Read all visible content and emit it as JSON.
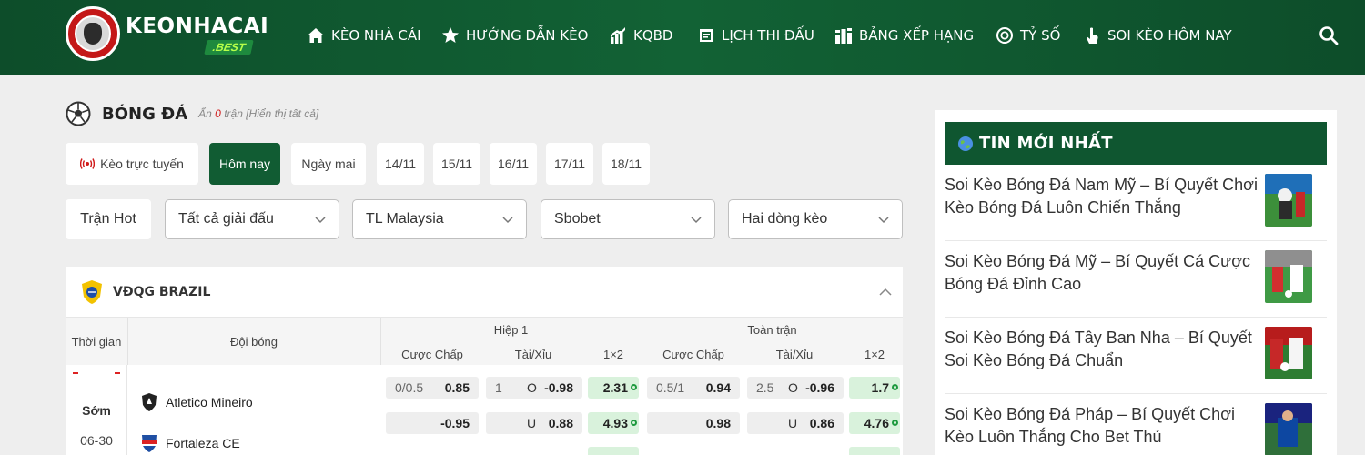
{
  "brand": {
    "name": "KEONHACAI",
    "sub": ".BEST"
  },
  "nav": [
    {
      "label": "KÈO NHÀ CÁI",
      "icon": "home-icon"
    },
    {
      "label": "HƯỚNG DẪN KÈO",
      "icon": "star-icon"
    },
    {
      "label": "KQBD",
      "icon": "bar-chart-icon"
    },
    {
      "label": "LỊCH THI ĐẤU",
      "icon": "calendar-icon"
    },
    {
      "label": "BẢNG XẾP HẠNG",
      "icon": "ranking-icon"
    },
    {
      "label": "TỶ SỐ",
      "icon": "target-icon"
    },
    {
      "label": "SOI KÈO HÔM NAY",
      "icon": "touch-icon"
    }
  ],
  "section": {
    "title": "BÓNG ĐÁ",
    "hint_prefix": "Ẩn",
    "hint_count": "0",
    "hint_suffix": "trận [Hiển thị tất cả]"
  },
  "date_tabs": [
    {
      "label": "Kèo trực tuyến",
      "active": false
    },
    {
      "label": "Hôm nay",
      "active": true
    },
    {
      "label": "Ngày mai",
      "active": false
    },
    {
      "label": "14/11",
      "active": false
    },
    {
      "label": "15/11",
      "active": false
    },
    {
      "label": "16/11",
      "active": false
    },
    {
      "label": "17/11",
      "active": false
    },
    {
      "label": "18/11",
      "active": false
    }
  ],
  "filters": {
    "hot_label": "Trận Hot",
    "selects": [
      "Tất cả giải đấu",
      "TL Malaysia",
      "Sbobet",
      "Hai dòng kèo"
    ]
  },
  "league": {
    "name": "VĐQG BRAZIL"
  },
  "table": {
    "col_time": "Thời gian",
    "col_team": "Đội bóng",
    "group_first_half": "Hiệp 1",
    "group_full": "Toàn trận",
    "sub_handicap": "Cược Chấp",
    "sub_overunder": "Tài/Xỉu",
    "sub_1x2": "1×2"
  },
  "match": {
    "status": "Sớm",
    "kickoff": "06-30",
    "home": "Atletico Mineiro",
    "away": "Fortaleza CE",
    "rows": [
      {
        "h1_hc_line": "0/0.5",
        "h1_hc_val": "0.85",
        "h1_ou_line": "1",
        "h1_ou_side": "O",
        "h1_ou_val": "-0.98",
        "h1_1x2": "2.31",
        "ft_hc_line": "0.5/1",
        "ft_hc_val": "0.94",
        "ft_ou_line": "2.5",
        "ft_ou_side": "O",
        "ft_ou_val": "-0.96",
        "ft_1x2": "1.7"
      },
      {
        "h1_hc_line": "",
        "h1_hc_val": "-0.95",
        "h1_ou_line": "",
        "h1_ou_side": "U",
        "h1_ou_val": "0.88",
        "h1_1x2": "4.93",
        "ft_hc_line": "",
        "ft_hc_val": "0.98",
        "ft_ou_line": "",
        "ft_ou_side": "U",
        "ft_ou_val": "0.86",
        "ft_1x2": "4.76"
      }
    ]
  },
  "sidebar": {
    "title": "TIN MỚI NHẤT",
    "news": [
      {
        "title": "Soi Kèo Bóng Đá Nam Mỹ – Bí Quyết Chơi Kèo Bóng Đá Luôn Chiến Thắng"
      },
      {
        "title": "Soi Kèo Bóng Đá Mỹ – Bí Quyết Cá Cược Bóng Đá Đỉnh Cao"
      },
      {
        "title": "Soi Kèo Bóng Đá Tây Ban Nha – Bí Quyết Soi Kèo Bóng Đá Chuẩn"
      },
      {
        "title": "Soi Kèo Bóng Đá Pháp – Bí Quyết Chơi Kèo Luôn Thắng Cho Bet Thủ"
      }
    ]
  },
  "colors": {
    "header_green": "#126235",
    "accent_green": "#115c33",
    "odds_highlight": "#d9f2dc",
    "live_red": "#d01a1a"
  }
}
